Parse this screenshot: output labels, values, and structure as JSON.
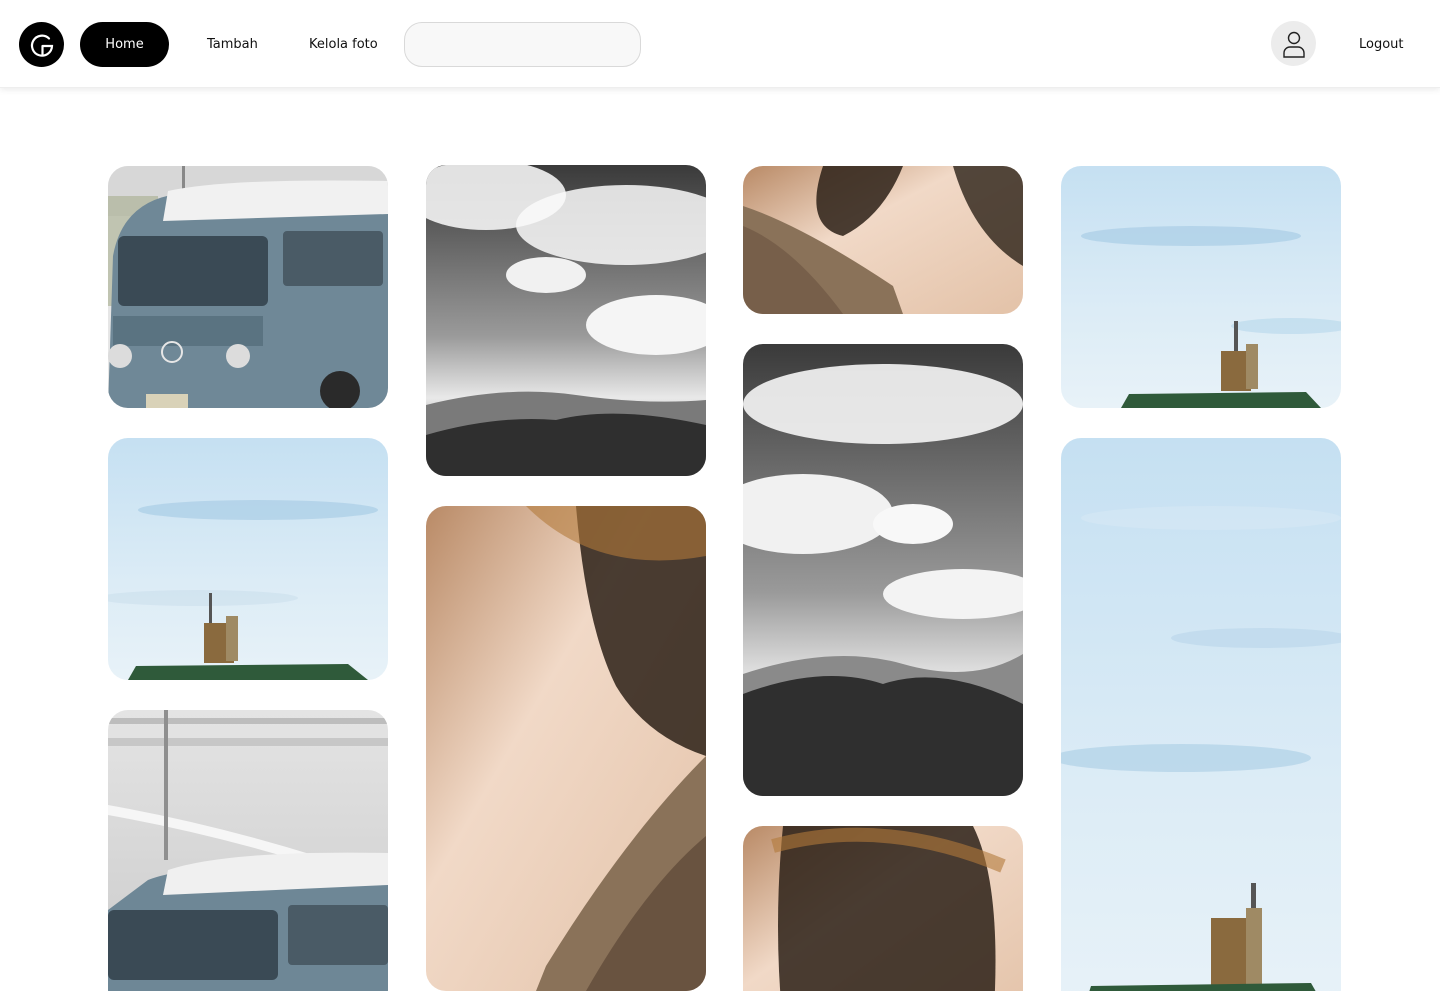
{
  "header": {
    "nav": {
      "home": "Home",
      "add": "Tambah",
      "manage": "Kelola foto"
    },
    "search": {
      "value": "",
      "placeholder": ""
    },
    "logout": "Logout",
    "icons": {
      "logo": "brand-logo-icon",
      "profile": "user-icon"
    }
  },
  "gallery": {
    "photos": [
      {
        "subject": "van"
      },
      {
        "subject": "sky-boat"
      },
      {
        "subject": "van"
      },
      {
        "subject": "clouds-mountains"
      },
      {
        "subject": "rock-mist"
      },
      {
        "subject": "rock-mist"
      },
      {
        "subject": "clouds-mountains"
      },
      {
        "subject": "rock-mist"
      },
      {
        "subject": "sky-boat"
      },
      {
        "subject": "sky-boat"
      }
    ]
  },
  "colors": {
    "accent": "#000000",
    "background": "#ffffff",
    "avatar_bg": "#ececec"
  }
}
